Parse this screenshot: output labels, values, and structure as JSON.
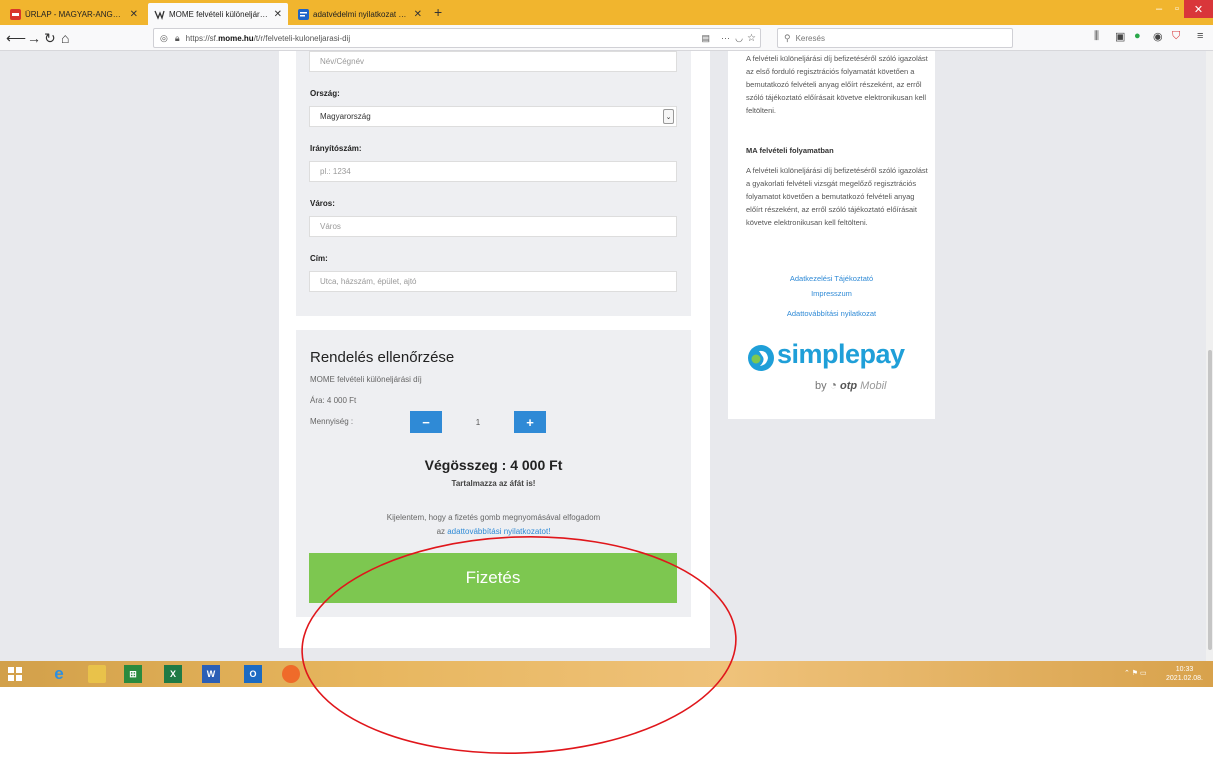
{
  "browser": {
    "tabs": [
      {
        "title": "ÜRLAP - MAGYAR-ANGOL SZO",
        "close": "✕"
      },
      {
        "title": "MOME felvételi különeljárási díj",
        "close": "✕"
      },
      {
        "title": "adatvédelmi nyilatkozat - Ango",
        "close": "✕"
      }
    ],
    "new_tab": "+",
    "url_prefix": "https://sf.",
    "url_domain": "mome.hu",
    "url_path": "/t/r/felveteli-kuloneljarasi-dij",
    "search_placeholder": "Keresés",
    "more_label": "···"
  },
  "form": {
    "name_placeholder": "Név/Cégnév",
    "country_label": "Ország:",
    "country_value": "Magyarország",
    "zip_label": "Irányítószám:",
    "zip_placeholder": "pl.: 1234",
    "city_label": "Város:",
    "city_placeholder": "Város",
    "address_label": "Cím:",
    "address_placeholder": "Utca, házszám, épület, ajtó"
  },
  "order": {
    "title": "Rendelés ellenőrzése",
    "product": "MOME felvételi különeljárási díj",
    "price": "Ára: 4 000 Ft",
    "quantity_label": "Mennyiség :",
    "minus": "−",
    "plus": "+",
    "quantity": "1",
    "total": "Végösszeg : 4 000 Ft",
    "vat_note": "Tartalmazza az áfát is!",
    "accept_text": "Kijelentem, hogy a fizetés gomb megnyomásával elfogadom",
    "accept_link_prefix": "az ",
    "accept_link": "adattovábbítási nyilatkozatot!",
    "pay_button": "Fizetés"
  },
  "sidebar": {
    "para1": "A felvételi különeljárási díj befizetéséről szóló igazolást az első forduló regisztrációs folyamatát követően a bemutatkozó felvételi anyag előírt részeként, az erről szóló tájékoztató előírásait követve elektronikusan kell feltölteni.",
    "heading2": "MA felvételi folyamatban",
    "para2": "A felvételi különeljárási díj befizetéséről szóló igazolást a gyakorlati felvételi vizsgát megelőző regisztrációs folyamatot követően a bemutatkozó felvételi anyag előírt részeként, az erről szóló tájékoztató előírásait követve elektronikusan kell feltölteni.",
    "link1": "Adatkezelési Tájékoztató",
    "link2": "Impresszum",
    "link3": "Adattovábbítási nyilatkozat",
    "logo_text": "simplepay",
    "by": "by",
    "otp": "otp",
    "mobil": "Mobil"
  },
  "taskbar": {
    "time": "10:33",
    "date": "2021.02.08."
  },
  "colors": {
    "accent_blue": "#2f8ad6",
    "pay_green": "#7dc750",
    "annotation_red": "#e0161b"
  }
}
